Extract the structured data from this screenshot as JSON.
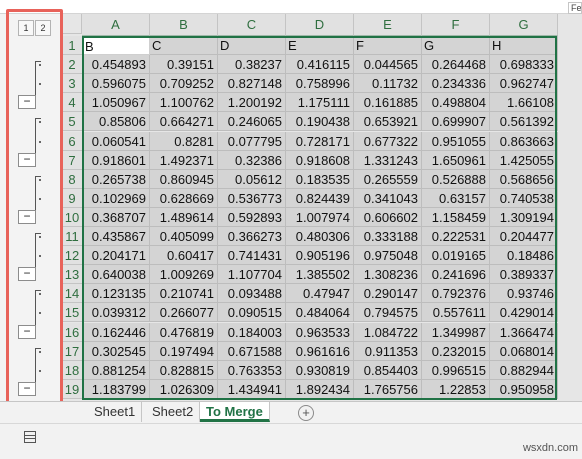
{
  "formula_bar": {
    "fx_text": "Fe"
  },
  "outline": {
    "level_buttons": [
      "1",
      "2"
    ]
  },
  "columns": [
    "A",
    "B",
    "C",
    "D",
    "E",
    "F",
    "G"
  ],
  "rows": [
    {
      "num": "1",
      "cells": [
        "B",
        "C",
        "D",
        "E",
        "F",
        "G",
        "H"
      ]
    },
    {
      "num": "2",
      "cells": [
        "0.454893",
        "0.39151",
        "0.38237",
        "0.416115",
        "0.044565",
        "0.264468",
        "0.698333"
      ]
    },
    {
      "num": "3",
      "cells": [
        "0.596075",
        "0.709252",
        "0.827148",
        "0.758996",
        "0.11732",
        "0.234336",
        "0.962747"
      ]
    },
    {
      "num": "4",
      "cells": [
        "1.050967",
        "1.100762",
        "1.200192",
        "1.175111",
        "0.161885",
        "0.498804",
        "1.66108"
      ]
    },
    {
      "num": "5",
      "cells": [
        "0.85806",
        "0.664271",
        "0.246065",
        "0.190438",
        "0.653921",
        "0.699907",
        "0.561392"
      ]
    },
    {
      "num": "6",
      "cells": [
        "0.060541",
        "0.8281",
        "0.077795",
        "0.728171",
        "0.677322",
        "0.951055",
        "0.863663"
      ]
    },
    {
      "num": "7",
      "cells": [
        "0.918601",
        "1.492371",
        "0.32386",
        "0.918608",
        "1.331243",
        "1.650961",
        "1.425055"
      ]
    },
    {
      "num": "8",
      "cells": [
        "0.265738",
        "0.860945",
        "0.05612",
        "0.183535",
        "0.265559",
        "0.526888",
        "0.568656"
      ]
    },
    {
      "num": "9",
      "cells": [
        "0.102969",
        "0.628669",
        "0.536773",
        "0.824439",
        "0.341043",
        "0.63157",
        "0.740538"
      ]
    },
    {
      "num": "10",
      "cells": [
        "0.368707",
        "1.489614",
        "0.592893",
        "1.007974",
        "0.606602",
        "1.158459",
        "1.309194"
      ]
    },
    {
      "num": "11",
      "cells": [
        "0.435867",
        "0.405099",
        "0.366273",
        "0.480306",
        "0.333188",
        "0.222531",
        "0.204477"
      ]
    },
    {
      "num": "12",
      "cells": [
        "0.204171",
        "0.60417",
        "0.741431",
        "0.905196",
        "0.975048",
        "0.019165",
        "0.18486"
      ]
    },
    {
      "num": "13",
      "cells": [
        "0.640038",
        "1.009269",
        "1.107704",
        "1.385502",
        "1.308236",
        "0.241696",
        "0.389337"
      ]
    },
    {
      "num": "14",
      "cells": [
        "0.123135",
        "0.210741",
        "0.093488",
        "0.47947",
        "0.290147",
        "0.792376",
        "0.93746"
      ]
    },
    {
      "num": "15",
      "cells": [
        "0.039312",
        "0.266077",
        "0.090515",
        "0.484064",
        "0.794575",
        "0.557611",
        "0.429014"
      ]
    },
    {
      "num": "16",
      "cells": [
        "0.162446",
        "0.476819",
        "0.184003",
        "0.963533",
        "1.084722",
        "1.349987",
        "1.366474"
      ]
    },
    {
      "num": "17",
      "cells": [
        "0.302545",
        "0.197494",
        "0.671588",
        "0.961616",
        "0.911353",
        "0.232015",
        "0.068014"
      ]
    },
    {
      "num": "18",
      "cells": [
        "0.881254",
        "0.828815",
        "0.763353",
        "0.930819",
        "0.854403",
        "0.996515",
        "0.882944"
      ]
    },
    {
      "num": "19",
      "cells": [
        "1.183799",
        "1.026309",
        "1.434941",
        "1.892434",
        "1.765756",
        "1.22853",
        "0.950958"
      ]
    }
  ],
  "sheet_tabs": [
    {
      "label": "Sheet1",
      "active": false
    },
    {
      "label": "Sheet2",
      "active": false
    },
    {
      "label": "To Merge",
      "active": true
    }
  ],
  "add_sheet_label": "+",
  "watermark": "wsxdn.com",
  "colors": {
    "accent_green": "#217346",
    "highlight_red": "#e8625a"
  }
}
